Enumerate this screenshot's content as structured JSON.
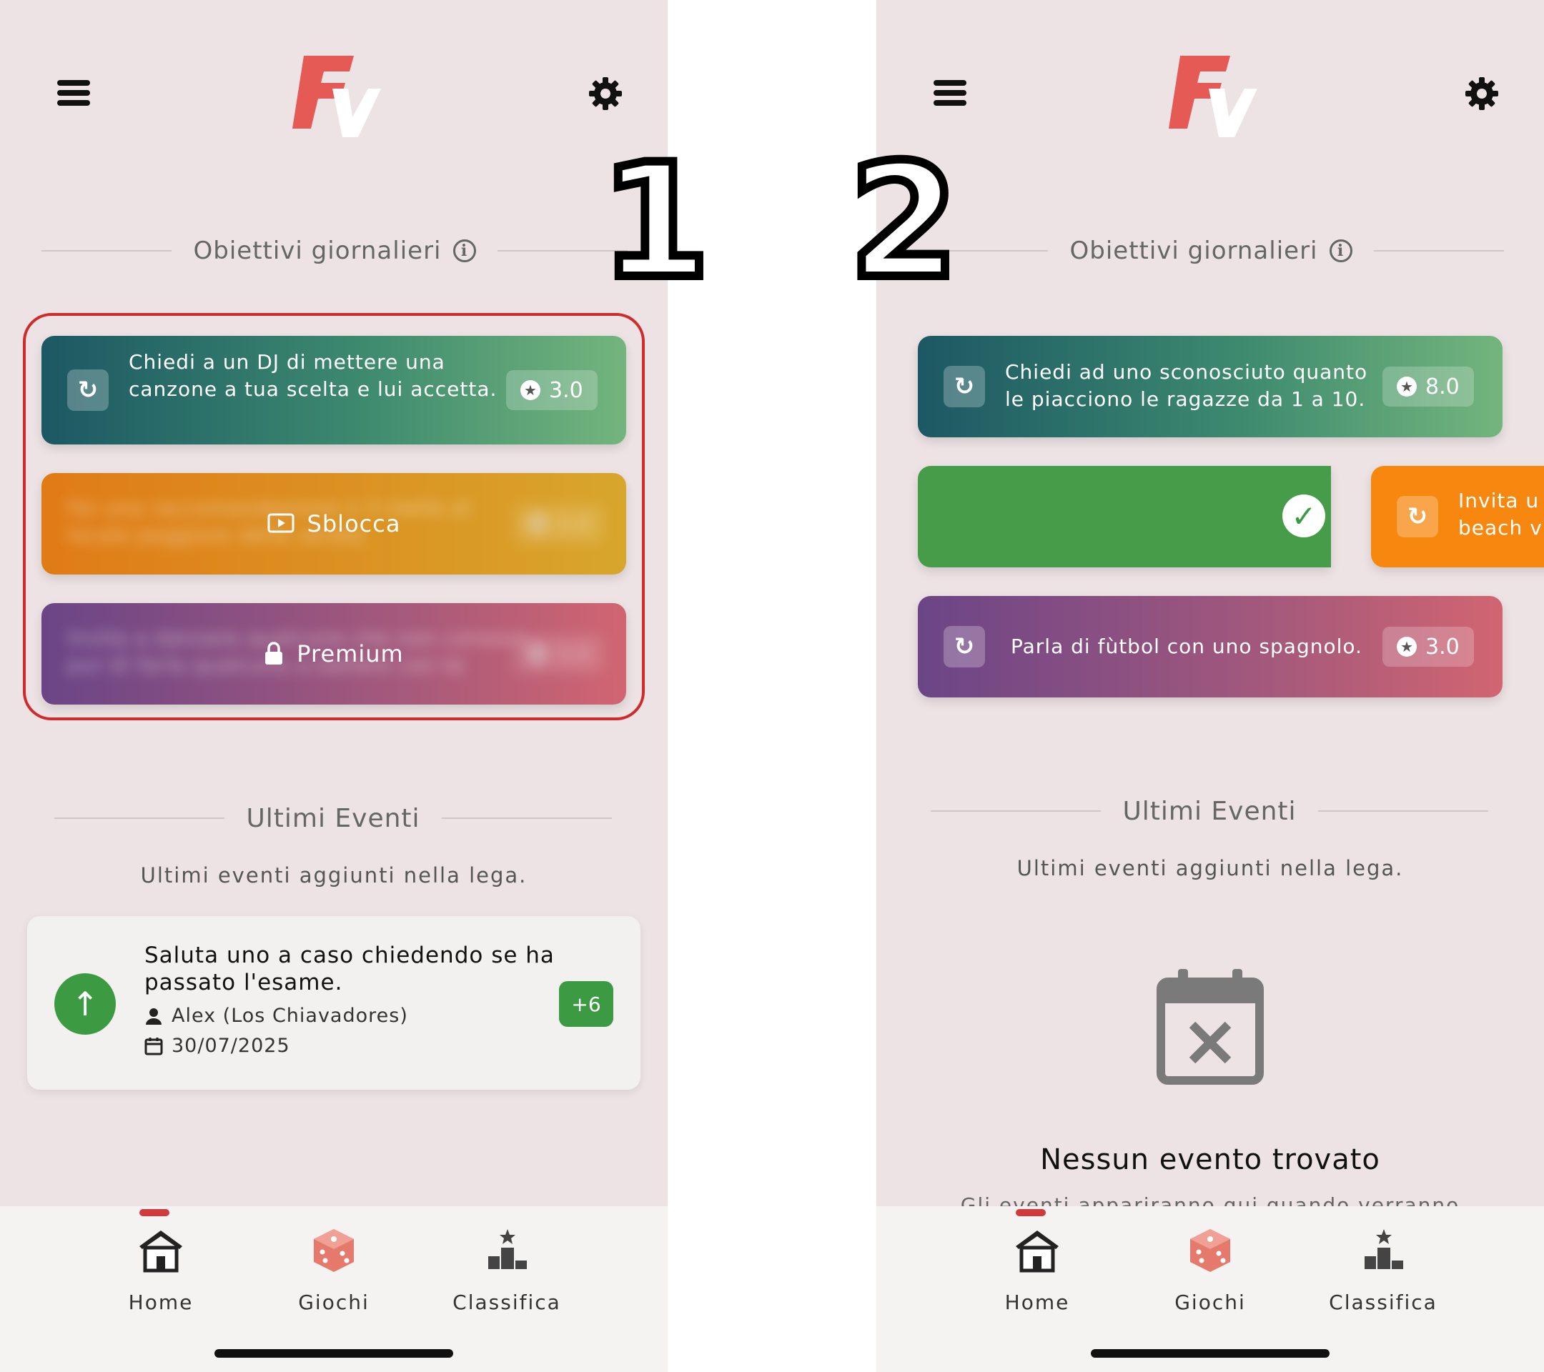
{
  "colors": {
    "accent_red": "#d03a3a",
    "green": "#3c9a42",
    "bg": "#ede3e4"
  },
  "labels": {
    "one": "1",
    "two": "2"
  },
  "header": {
    "menu_icon": "hamburger-icon",
    "settings_icon": "gear-icon",
    "logo_text_f": "F",
    "logo_text_v": "V"
  },
  "daily": {
    "title": "Obiettivi giornalieri",
    "info_icon": "info-icon"
  },
  "screen1": {
    "goals": [
      {
        "text": "Chiedi a un DJ di mettere una canzone a tua scelta e lui accetta.",
        "points": "3.0"
      },
      {
        "blurred_text": "Fai una raccomandazione o 3 stelle al locale peggiore della serata",
        "action": "Sblocca",
        "points": "3.0"
      },
      {
        "blurred_text": "Invita a danzare qualcuno che non conosci, pur di farla qualcuno a ballare con te",
        "action": "Premium",
        "points": "3.0"
      }
    ],
    "events": {
      "title": "Ultimi Eventi",
      "subtitle": "Ultimi eventi aggiunti nella lega.",
      "items": [
        {
          "title": "Saluta uno a caso chiedendo se ha passato l'esame.",
          "user": "Alex (Los Chiavadores)",
          "date": "30/07/2025",
          "badge": "+6"
        }
      ]
    }
  },
  "screen2": {
    "goals": [
      {
        "text": "Chiedi ad uno sconosciuto quanto le piacciono le ragazze da 1 a 10.",
        "points": "8.0"
      },
      {
        "swipe_text": "Invita u beach v"
      },
      {
        "text": "Parla di fùtbol con uno spagnolo.",
        "points": "3.0"
      }
    ],
    "events": {
      "title": "Ultimi Eventi",
      "subtitle": "Ultimi eventi aggiunti nella lega.",
      "empty_title": "Nessun evento trovato",
      "empty_sub": "Gli eventi appariranno qui quando verranno"
    }
  },
  "nav": {
    "home": "Home",
    "games": "Giochi",
    "ranking": "Classifica"
  }
}
